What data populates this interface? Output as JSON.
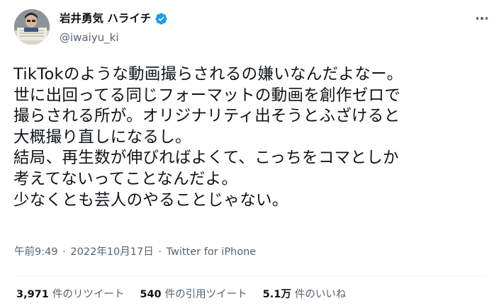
{
  "user": {
    "display_name": "岩井勇気 ハライチ",
    "handle": "@iwaiyu_ki",
    "verified": true
  },
  "tweet": {
    "lines": [
      "TikTokのような動画撮らされるの嫌いなんだよなー。",
      "世に出回ってる同じフォーマットの動画を創作ゼロで",
      "撮らされる所が。オリジナリティ出そうとふざけると",
      "大概撮り直しになるし。",
      "結局、再生数が伸びればよくて、こっちをコマとしか",
      "考えてないってことなんだよ。",
      "少なくとも芸人のやることじゃない。"
    ]
  },
  "meta": {
    "time": "午前9:49",
    "separator": "·",
    "date": "2022年10月17日",
    "source": "Twitter for iPhone"
  },
  "stats": {
    "retweets": {
      "value": "3,971",
      "label": "件のリツイート"
    },
    "quotes": {
      "value": "540",
      "label": "件の引用ツイート"
    },
    "likes": {
      "value": "5.1万",
      "label": "件のいいね"
    }
  },
  "icons": {
    "verified": "verified-badge-icon",
    "more": "more-options-icon"
  },
  "colors": {
    "text": "#0f1419",
    "secondary": "#536471",
    "verified": "#1d9bf0",
    "divider": "#eff3f4"
  }
}
